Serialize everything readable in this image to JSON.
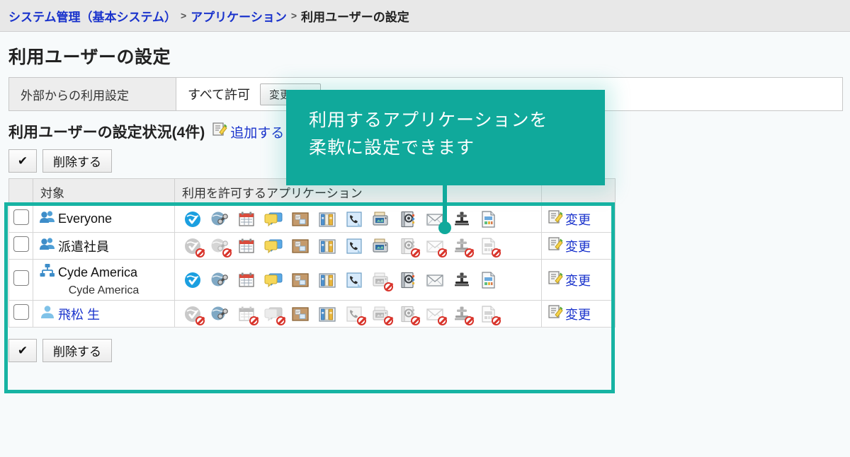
{
  "breadcrumb": {
    "items": [
      {
        "label": "システム管理（基本システム）",
        "link": true
      },
      {
        "label": "アプリケーション",
        "link": true
      },
      {
        "label": "利用ユーザーの設定",
        "link": false
      }
    ],
    "separator": ">"
  },
  "page": {
    "title": "利用ユーザーの設定"
  },
  "filter": {
    "label": "外部からの利用設定",
    "value": "すべて許可",
    "change_button": "変更する"
  },
  "status": {
    "text": "利用ユーザーの設定状況(4件)",
    "add_link": "追加する",
    "add_icon": "add-document-icon"
  },
  "toolbar": {
    "check_all_label": "✔",
    "delete_label": "削除する"
  },
  "table": {
    "headers": {
      "check": "",
      "target": "対象",
      "apps": "利用を許可するアプリケーション",
      "edit": ""
    },
    "app_icon_names": [
      "portal-icon",
      "link-icon",
      "scheduler-icon",
      "messages-icon",
      "bulletin-board-icon",
      "cabinet-icon",
      "phone-memo-icon",
      "multireport-icon",
      "address-book-icon",
      "e-mail-icon",
      "workflow-icon",
      "report-icon"
    ],
    "edit_link_label": "変更",
    "edit_icon": "edit-document-icon",
    "rows": [
      {
        "target": "Everyone",
        "target_sub": "",
        "target_icon": "group-icon",
        "target_is_link": false,
        "apps_enabled": [
          true,
          true,
          true,
          true,
          true,
          true,
          true,
          true,
          true,
          true,
          true,
          true
        ]
      },
      {
        "target": "派遣社員",
        "target_sub": "",
        "target_icon": "group-icon",
        "target_is_link": false,
        "apps_enabled": [
          false,
          false,
          true,
          true,
          true,
          true,
          true,
          true,
          false,
          false,
          false,
          false
        ]
      },
      {
        "target": "Cyde America",
        "target_sub": "Cyde America",
        "target_icon": "organization-icon",
        "target_is_link": false,
        "apps_enabled": [
          true,
          true,
          true,
          true,
          true,
          true,
          true,
          false,
          true,
          true,
          true,
          true
        ]
      },
      {
        "target": "飛松 生",
        "target_sub": "",
        "target_icon": "user-icon",
        "target_is_link": true,
        "apps_enabled": [
          false,
          true,
          false,
          false,
          true,
          true,
          false,
          false,
          false,
          false,
          false,
          false
        ]
      }
    ]
  },
  "callout": {
    "line1": "利用するアプリケーションを",
    "line2": "柔軟に設定できます",
    "color": "#10a99b"
  },
  "colors": {
    "accent_teal": "#17b3a3",
    "link_blue": "#1a33cc",
    "header_gray": "#ededed",
    "page_bg": "#f7fafb"
  }
}
